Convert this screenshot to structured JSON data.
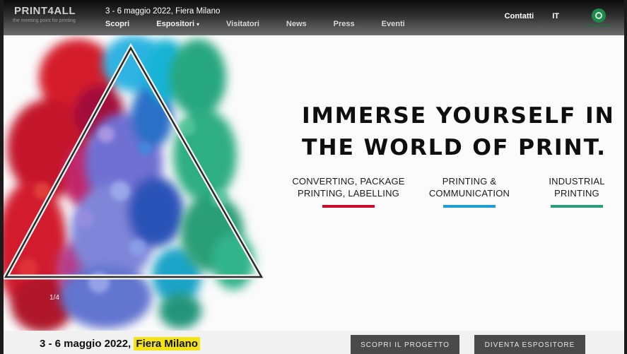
{
  "header": {
    "logo_text": "PRINT4ALL",
    "logo_tagline": "the meeting point for printing",
    "event_date": "3 - 6 maggio 2022, Fiera Milano",
    "nav": [
      {
        "label": "Scopri",
        "has_dropdown": false
      },
      {
        "label": "Espositori",
        "has_dropdown": true
      },
      {
        "label": "Visitatori",
        "has_dropdown": false
      },
      {
        "label": "News",
        "has_dropdown": false
      },
      {
        "label": "Press",
        "has_dropdown": false
      },
      {
        "label": "Eventi",
        "has_dropdown": false
      }
    ],
    "contact_label": "Contatti",
    "language": "IT",
    "partner_logo_text": "FIERA MILANO"
  },
  "hero": {
    "headline_line1": "IMMERSE YOURSELF IN",
    "headline_line2": "THE WORLD OF PRINT.",
    "slide_counter": "1/4",
    "sectors": [
      {
        "line1": "CONVERTING, PACKAGE",
        "line2": "PRINTING, LABELLING",
        "color": "#c8102e"
      },
      {
        "line1": "PRINTING &",
        "line2": "COMMUNICATION",
        "color": "#1f9ed1"
      },
      {
        "line1": "INDUSTRIAL",
        "line2": "PRINTING",
        "color": "#2d9c7b"
      }
    ]
  },
  "footer_strip": {
    "date_text": "3 - 6 maggio 2022,",
    "venue_highlight": "Fiera Milano",
    "button_1": "SCOPRI IL PROGETTO",
    "button_2": "DIVENTA ESPOSITORE"
  },
  "colors": {
    "accent_yellow": "#f4e416",
    "button_bg": "#4a4a4a",
    "brand_green": "#1f8a4c"
  }
}
